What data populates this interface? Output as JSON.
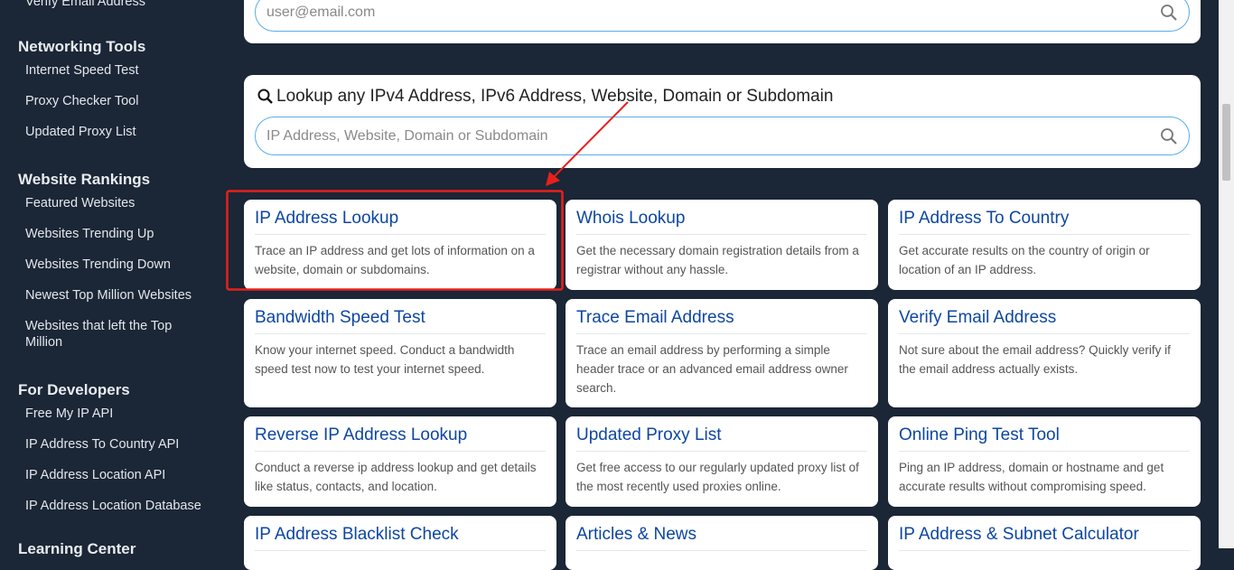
{
  "sidebar": {
    "cut_item": "Verify Email Address",
    "sections": [
      {
        "heading": "Networking Tools",
        "items": [
          "Internet Speed Test",
          "Proxy Checker Tool",
          "Updated Proxy List"
        ]
      },
      {
        "heading": "Website Rankings",
        "items": [
          "Featured Websites",
          "Websites Trending Up",
          "Websites Trending Down",
          "Newest Top Million Websites",
          "Websites that left the Top Million"
        ]
      },
      {
        "heading": "For Developers",
        "items": [
          "Free My IP API",
          "IP Address To Country API",
          "IP Address Location API",
          "IP Address Location Database"
        ]
      }
    ],
    "cut_heading": "Learning Center"
  },
  "email_search": {
    "value": "user@email.com"
  },
  "lookup": {
    "heading": "Lookup any IPv4 Address, IPv6 Address, Website, Domain or Subdomain",
    "placeholder": "IP Address, Website, Domain or Subdomain"
  },
  "cards": [
    {
      "title": "IP Address Lookup",
      "desc": "Trace an IP address and get lots of information on a website, domain or subdomains."
    },
    {
      "title": "Whois Lookup",
      "desc": "Get the necessary domain registration details from a registrar without any hassle."
    },
    {
      "title": "IP Address To Country",
      "desc": "Get accurate results on the country of origin or location of an IP address."
    },
    {
      "title": "Bandwidth Speed Test",
      "desc": "Know your internet speed. Conduct a bandwidth speed test now to test your internet speed."
    },
    {
      "title": "Trace Email Address",
      "desc": "Trace an email address by performing a simple header trace or an advanced email address owner search."
    },
    {
      "title": "Verify Email Address",
      "desc": "Not sure about the email address? Quickly verify if the email address actually exists."
    },
    {
      "title": "Reverse IP Address Lookup",
      "desc": "Conduct a reverse ip address lookup and get details like status, contacts, and location."
    },
    {
      "title": "Updated Proxy List",
      "desc": "Get free access to our regularly updated proxy list of the most recently used proxies online."
    },
    {
      "title": "Online Ping Test Tool",
      "desc": "Ping an IP address, domain or hostname and get accurate results without compromising speed."
    },
    {
      "title": "IP Address Blacklist Check",
      "desc": ""
    },
    {
      "title": "Articles & News",
      "desc": ""
    },
    {
      "title": "IP Address & Subnet Calculator",
      "desc": ""
    }
  ],
  "colors": {
    "background": "#1b2636",
    "card_title": "#0d47a1",
    "annotation": "#e8201a"
  }
}
